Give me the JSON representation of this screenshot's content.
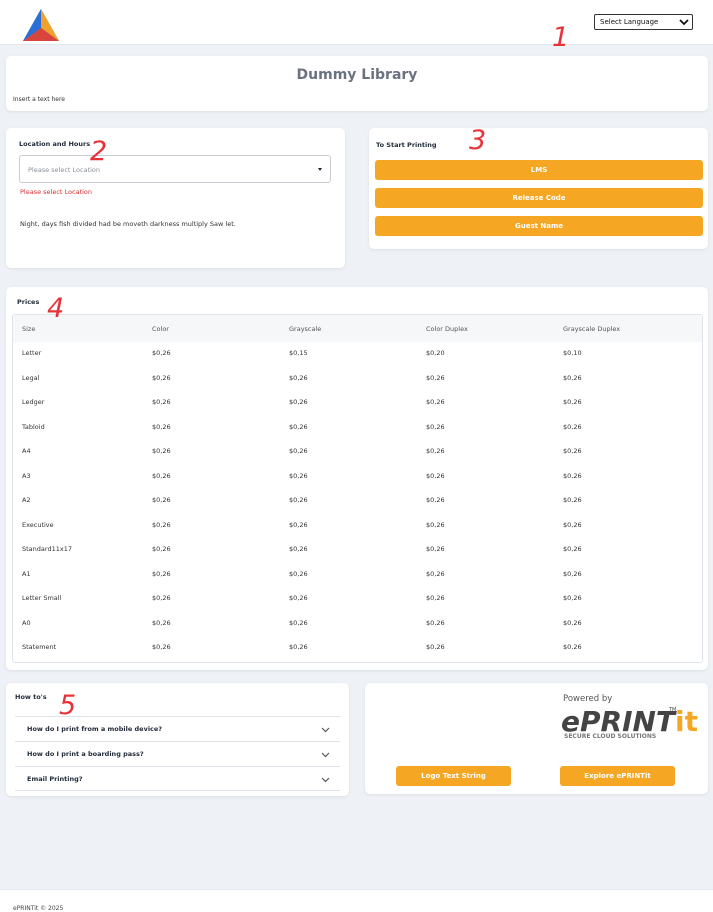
{
  "header": {
    "language_select": "Select Language"
  },
  "annotations": [
    "1",
    "2",
    "3",
    "4",
    "5"
  ],
  "library": {
    "title": "Dummy Library",
    "subtitle": "Insert a text here"
  },
  "location": {
    "title": "Location and Hours",
    "placeholder": "Please select Location",
    "error": "Please select Location",
    "description": "Night, days fish divided had be moveth darkness multiply Saw let."
  },
  "printing": {
    "title": "To Start Printing",
    "buttons": [
      "LMS",
      "Release Code",
      "Guest Name"
    ]
  },
  "prices": {
    "title": "Prices",
    "columns": [
      "Size",
      "Color",
      "Grayscale",
      "Color Duplex",
      "Grayscale Duplex"
    ],
    "rows": [
      [
        "Letter",
        "$0,26",
        "$0,15",
        "$0,20",
        "$0,10"
      ],
      [
        "Legal",
        "$0,26",
        "$0,26",
        "$0,26",
        "$0,26"
      ],
      [
        "Ledger",
        "$0,26",
        "$0,26",
        "$0,26",
        "$0,26"
      ],
      [
        "Tabloid",
        "$0,26",
        "$0,26",
        "$0,26",
        "$0,26"
      ],
      [
        "A4",
        "$0,26",
        "$0,26",
        "$0,26",
        "$0,26"
      ],
      [
        "A3",
        "$0,26",
        "$0,26",
        "$0,26",
        "$0,26"
      ],
      [
        "A2",
        "$0,26",
        "$0,26",
        "$0,26",
        "$0,26"
      ],
      [
        "Executive",
        "$0,26",
        "$0,26",
        "$0,26",
        "$0,26"
      ],
      [
        "Standard11x17",
        "$0,26",
        "$0,26",
        "$0,26",
        "$0,26"
      ],
      [
        "A1",
        "$0,26",
        "$0,26",
        "$0,26",
        "$0,26"
      ],
      [
        "Letter Small",
        "$0,26",
        "$0,26",
        "$0,26",
        "$0,26"
      ],
      [
        "A0",
        "$0,26",
        "$0,26",
        "$0,26",
        "$0,26"
      ],
      [
        "Statement",
        "$0,26",
        "$0,26",
        "$0,26",
        "$0,26"
      ]
    ]
  },
  "howto": {
    "title": "How to's",
    "items": [
      "How do I print from a mobile device?",
      "How do I print a boarding pass?",
      "Email Printing?"
    ]
  },
  "brand": {
    "powered_by": "Powered by",
    "logo_main": "ePRINT",
    "logo_it": "it",
    "logo_tm": "TM",
    "tagline": "SECURE CLOUD SOLUTIONS",
    "buttons": [
      "Logo Text String",
      "Explore ePRINTit"
    ]
  },
  "footer": {
    "copyright": "ePRINTit © 2025"
  },
  "colors": {
    "accent": "#f5a623",
    "error": "#d93030",
    "annotation": "#e8323a"
  }
}
